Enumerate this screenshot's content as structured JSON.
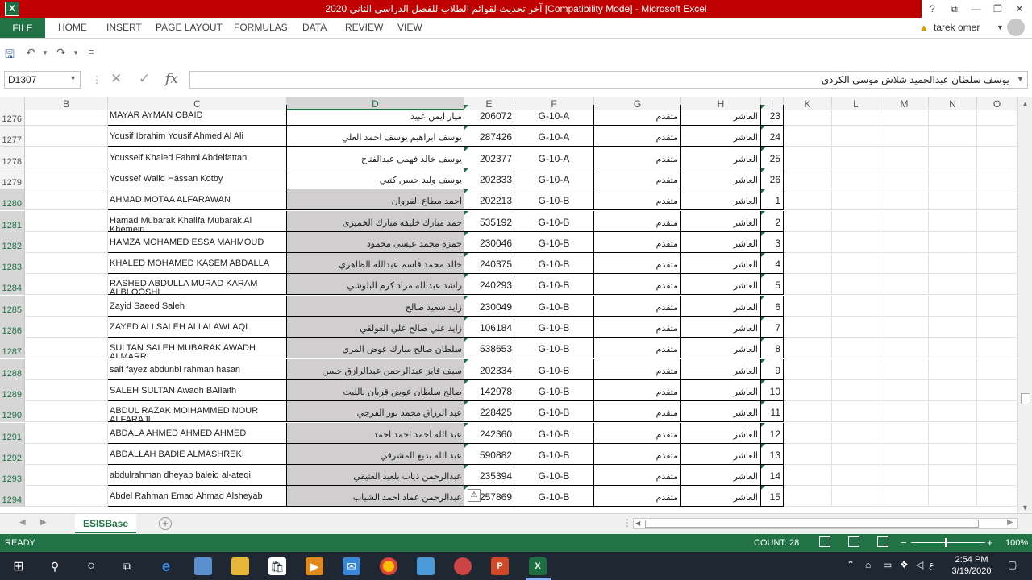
{
  "window": {
    "title": "آخر تحديث لقوائم الطلاب للفصل الدراسي الثاني 2020  [Compatibility Mode] -  Microsoft Excel",
    "logo": "X",
    "controls": [
      "?",
      "⧉",
      "—",
      "❐",
      "✕"
    ]
  },
  "ribbon": {
    "file_label": "FILE",
    "tabs": [
      "HOME",
      "INSERT",
      "PAGE LAYOUT",
      "FORMULAS",
      "DATA",
      "REVIEW",
      "VIEW"
    ],
    "user": "tarek omer"
  },
  "formula_bar": {
    "name_box": "D1307",
    "content": "يوسف سلطان عبدالحميد شلاش موسى الكردي"
  },
  "columns": [
    "B",
    "C",
    "D",
    "E",
    "F",
    "G",
    "H",
    "I",
    "K",
    "L",
    "M",
    "N",
    "O"
  ],
  "selected_column": "D",
  "rows": [
    {
      "num": "1276",
      "en": "MAYAR AYMAN OBAID",
      "ar": "ميار ايمن عبيد",
      "id": "206072",
      "section": "G-10-A",
      "level": "متقدم",
      "grade": "العاشر",
      "idx": "23",
      "shade": false,
      "sel": false
    },
    {
      "num": "1277",
      "en": "Yousif Ibrahim Yousif Ahmed Al Ali",
      "ar": "يوسف ابراهيم يوسف احمد العلي",
      "id": "287426",
      "section": "G-10-A",
      "level": "متقدم",
      "grade": "العاشر",
      "idx": "24",
      "shade": false,
      "sel": false
    },
    {
      "num": "1278",
      "en": "Yousseif Khaled Fahmi Abdelfattah",
      "ar": "يوسف خالد فهمى عبدالفتاح",
      "id": "202377",
      "section": "G-10-A",
      "level": "متقدم",
      "grade": "العاشر",
      "idx": "25",
      "shade": false,
      "sel": false
    },
    {
      "num": "1279",
      "en": "Youssef Walid Hassan Kotby",
      "ar": "يوسف وليد حسن كتبي",
      "id": "202333",
      "section": "G-10-A",
      "level": "متقدم",
      "grade": "العاشر",
      "idx": "26",
      "shade": false,
      "sel": false
    },
    {
      "num": "1280",
      "en": "AHMAD MOTAA ALFARAWAN",
      "ar": "احمد مطاع الفروان",
      "id": "202213",
      "section": "G-10-B",
      "level": "متقدم",
      "grade": "العاشر",
      "idx": "1",
      "shade": true,
      "sel": true
    },
    {
      "num": "1281",
      "en": "Hamad Mubarak Khalifa Mubarak Al Khemeiri",
      "ar": "حمد مبارك خليفه مبارك الخميرى",
      "id": "535192",
      "section": "G-10-B",
      "level": "متقدم",
      "grade": "العاشر",
      "idx": "2",
      "shade": true,
      "sel": true
    },
    {
      "num": "1282",
      "en": "HAMZA MOHAMED ESSA MAHMOUD",
      "ar": "حمزة محمد عيسى محمود",
      "id": "230046",
      "section": "G-10-B",
      "level": "متقدم",
      "grade": "العاشر",
      "idx": "3",
      "shade": true,
      "sel": true
    },
    {
      "num": "1283",
      "en": "KHALED MOHAMED KASEM ABDALLA",
      "ar": "خالد محمد قاسم عبدالله الظاهري",
      "id": "240375",
      "section": "G-10-B",
      "level": "متقدم",
      "grade": "العاشر",
      "idx": "4",
      "shade": true,
      "sel": true
    },
    {
      "num": "1284",
      "en": "RASHED ABDULLA MURAD KARAM ALBLOOSHI",
      "ar": "راشد عبدالله مراد كرم البلوشي",
      "id": "240293",
      "section": "G-10-B",
      "level": "متقدم",
      "grade": "العاشر",
      "idx": "5",
      "shade": true,
      "sel": true
    },
    {
      "num": "1285",
      "en": "Zayid Saeed Saleh",
      "ar": "زايد سعيد صالح",
      "id": "230049",
      "section": "G-10-B",
      "level": "متقدم",
      "grade": "العاشر",
      "idx": "6",
      "shade": true,
      "sel": true
    },
    {
      "num": "1286",
      "en": "ZAYED ALI SALEH ALI ALAWLAQI",
      "ar": "زايد علي صالح علي العولقي",
      "id": "106184",
      "section": "G-10-B",
      "level": "متقدم",
      "grade": "العاشر",
      "idx": "7",
      "shade": true,
      "sel": true
    },
    {
      "num": "1287",
      "en": "SULTAN SALEH MUBARAK AWADH ALMARRI",
      "ar": "سلطان صالح مبارك عوض المري",
      "id": "538653",
      "section": "G-10-B",
      "level": "متقدم",
      "grade": "العاشر",
      "idx": "8",
      "shade": true,
      "sel": true
    },
    {
      "num": "1288",
      "en": "saif fayez abdunbl rahman hasan",
      "ar": "سيف فايز عبدالرحمن عبدالرازق حسن",
      "id": "202334",
      "section": "G-10-B",
      "level": "متقدم",
      "grade": "العاشر",
      "idx": "9",
      "shade": true,
      "sel": true
    },
    {
      "num": "1289",
      "en": "SALEH SULTAN Awadh BAllaith",
      "ar": "صالح سلطان عوض قربان بالليث",
      "id": "142978",
      "section": "G-10-B",
      "level": "متقدم",
      "grade": "العاشر",
      "idx": "10",
      "shade": true,
      "sel": true
    },
    {
      "num": "1290",
      "en": "ABDUL RAZAK MOIHAMMED NOUR ALFARAJI",
      "ar": "عبد الرزاق محمد نور الفرجي",
      "id": "228425",
      "section": "G-10-B",
      "level": "متقدم",
      "grade": "العاشر",
      "idx": "11",
      "shade": true,
      "sel": true
    },
    {
      "num": "1291",
      "en": "ABDALA AHMED AHMED AHMED",
      "ar": "عبد الله احمد احمد احمد",
      "id": "242360",
      "section": "G-10-B",
      "level": "متقدم",
      "grade": "العاشر",
      "idx": "12",
      "shade": true,
      "sel": true
    },
    {
      "num": "1292",
      "en": "ABDALLAH BADIE ALMASHREKI",
      "ar": "عبد الله بديع المشرقي",
      "id": "590882",
      "section": "G-10-B",
      "level": "متقدم",
      "grade": "العاشر",
      "idx": "13",
      "shade": true,
      "sel": true
    },
    {
      "num": "1293",
      "en": "abdulrahman dheyab baleid al-ateqi",
      "ar": "عبدالرحمن ذياب بلعيد العتيقي",
      "id": "235394",
      "section": "G-10-B",
      "level": "متقدم",
      "grade": "العاشر",
      "idx": "14",
      "shade": true,
      "sel": true
    },
    {
      "num": "1294",
      "en": "Abdel Rahman Emad Ahmad Alsheyab",
      "ar": "عبدالرحمن عماد احمد الشياب",
      "id": "257869",
      "section": "G-10-B",
      "level": "متقدم",
      "grade": "العاشر",
      "idx": "15",
      "shade": true,
      "sel": true
    }
  ],
  "sheet": {
    "tab_label": "ESISBase",
    "add": "+"
  },
  "status": {
    "ready": "READY",
    "count": "COUNT: 28",
    "zoom": "100%",
    "zoom_minus": "−",
    "zoom_plus": "+"
  },
  "taskbar": {
    "time": "2:54 PM",
    "date": "3/19/2020",
    "lang": "ع"
  }
}
